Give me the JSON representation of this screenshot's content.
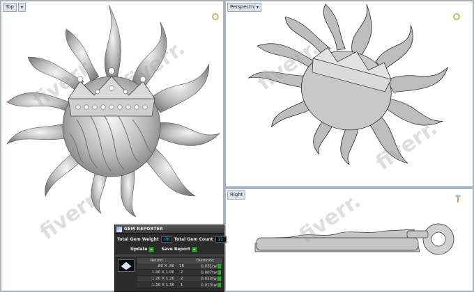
{
  "viewports": {
    "top": {
      "label": "Top"
    },
    "perspective": {
      "label": "Perspective"
    },
    "right": {
      "label": "Right"
    }
  },
  "watermark": "fiverr.",
  "gem_reporter": {
    "title": "GEM REPORTER",
    "total_weight_label": "Total Gem Weight",
    "total_weight_value": ".06",
    "total_count_label": "Total Gem Count",
    "total_count_value": "21",
    "update_label": "Update",
    "save_label": "Save Report",
    "columns": [
      "Round",
      "",
      "Diamond"
    ],
    "rows": [
      {
        "size": ".80 X .80",
        "count": "16",
        "weight": "0.031tw"
      },
      {
        "size": "1.00 X 1.00",
        "count": "2",
        "weight": "0.007tw"
      },
      {
        "size": "1.20 X 1.20",
        "count": "2",
        "weight": "0.013tw"
      },
      {
        "size": "1.50 X 1.50",
        "count": "1",
        "weight": "0.013tw"
      }
    ]
  }
}
